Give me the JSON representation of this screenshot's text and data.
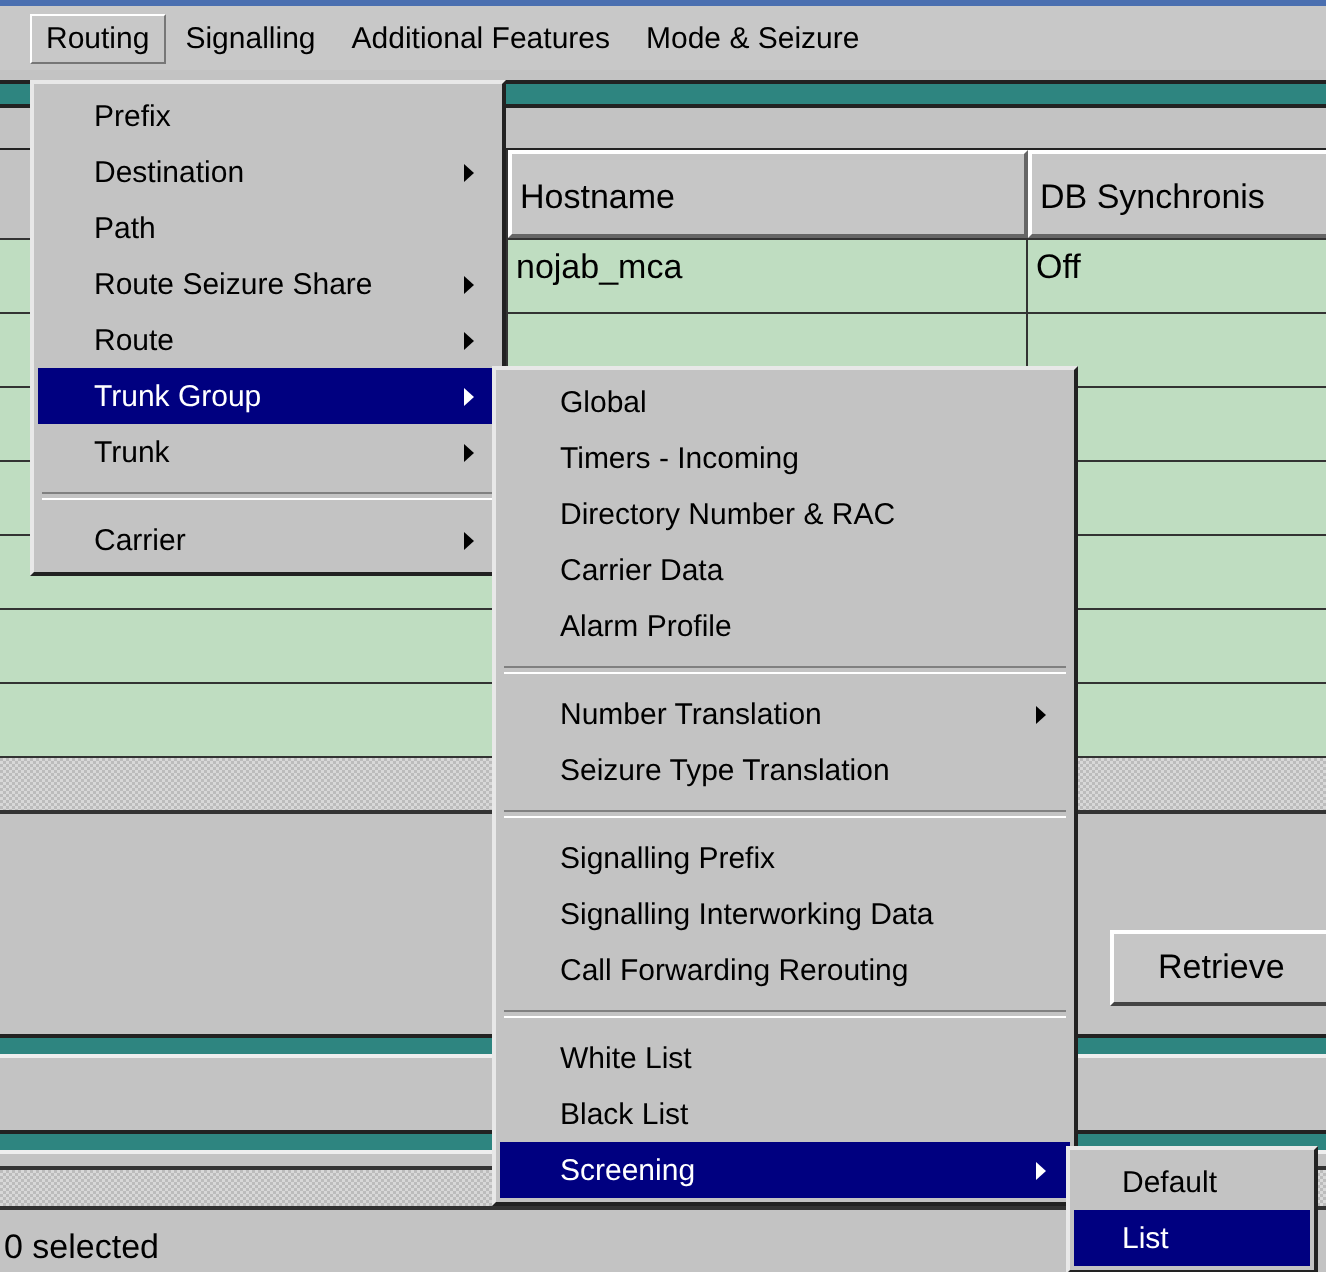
{
  "menubar": {
    "items": [
      {
        "label": "Routing",
        "selected": true
      },
      {
        "label": "Signalling",
        "selected": false
      },
      {
        "label": "Additional Features",
        "selected": false
      },
      {
        "label": "Mode & Seizure",
        "selected": false
      }
    ]
  },
  "table": {
    "columns": [
      "Hostname",
      "DB Synchronis"
    ],
    "rows": [
      [
        "nojab_mca",
        "Off"
      ]
    ]
  },
  "retrieve_button": "Retrieve",
  "status_bar": "0 selected",
  "routing_menu": [
    {
      "kind": "item",
      "label": "Prefix",
      "submenu": false,
      "selected": false
    },
    {
      "kind": "item",
      "label": "Destination",
      "submenu": true,
      "selected": false
    },
    {
      "kind": "item",
      "label": "Path",
      "submenu": false,
      "selected": false
    },
    {
      "kind": "item",
      "label": "Route Seizure Share",
      "submenu": true,
      "selected": false
    },
    {
      "kind": "item",
      "label": "Route",
      "submenu": true,
      "selected": false
    },
    {
      "kind": "item",
      "label": "Trunk Group",
      "submenu": true,
      "selected": true
    },
    {
      "kind": "item",
      "label": "Trunk",
      "submenu": true,
      "selected": false
    },
    {
      "kind": "separator"
    },
    {
      "kind": "item",
      "label": "Carrier",
      "submenu": true,
      "selected": false
    }
  ],
  "trunk_group_menu": [
    {
      "kind": "item",
      "label": "Global",
      "submenu": false,
      "selected": false
    },
    {
      "kind": "item",
      "label": "Timers - Incoming",
      "submenu": false,
      "selected": false
    },
    {
      "kind": "item",
      "label": "Directory Number & RAC",
      "submenu": false,
      "selected": false
    },
    {
      "kind": "item",
      "label": "Carrier Data",
      "submenu": false,
      "selected": false
    },
    {
      "kind": "item",
      "label": "Alarm Profile",
      "submenu": false,
      "selected": false
    },
    {
      "kind": "separator"
    },
    {
      "kind": "item",
      "label": "Number Translation",
      "submenu": true,
      "selected": false
    },
    {
      "kind": "item",
      "label": "Seizure Type Translation",
      "submenu": false,
      "selected": false
    },
    {
      "kind": "separator"
    },
    {
      "kind": "item",
      "label": "Signalling Prefix",
      "submenu": false,
      "selected": false
    },
    {
      "kind": "item",
      "label": "Signalling Interworking Data",
      "submenu": false,
      "selected": false
    },
    {
      "kind": "item",
      "label": "Call Forwarding Rerouting",
      "submenu": false,
      "selected": false
    },
    {
      "kind": "separator"
    },
    {
      "kind": "item",
      "label": "White List",
      "submenu": false,
      "selected": false
    },
    {
      "kind": "item",
      "label": "Black List",
      "submenu": false,
      "selected": false
    },
    {
      "kind": "item",
      "label": "Screening",
      "submenu": true,
      "selected": true
    }
  ],
  "screening_menu": [
    {
      "kind": "item",
      "label": "Default",
      "submenu": false,
      "selected": false
    },
    {
      "kind": "item",
      "label": "List",
      "submenu": false,
      "selected": true
    }
  ]
}
